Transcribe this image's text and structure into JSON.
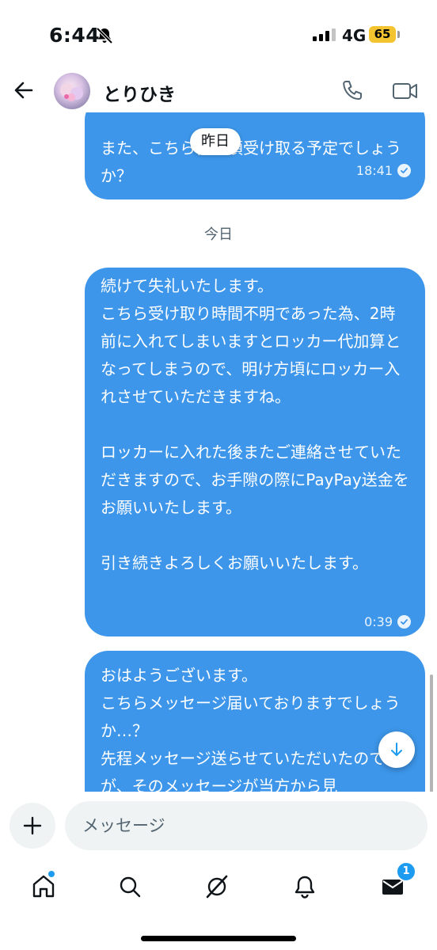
{
  "status_bar": {
    "time": "6:44",
    "network": "4G",
    "battery": "65"
  },
  "header": {
    "contact_name": "とりひき"
  },
  "messages": {
    "date_pill": "昨日",
    "date_separator": "今日",
    "items": [
      {
        "text": "また、こちら何時頃受け取る予定でしょうか？",
        "time": "18:41"
      },
      {
        "text": "続けて失礼いたします。\nこちら受け取り時間不明であった為、2時前に入れてしまいますとロッカー代加算となってしまうので、明け方頃にロッカー入れさせていただきますね。\n\nロッカーに入れた後またご連絡させていただきますので、お手隙の際にPayPay送金をお願いいたします。\n\n引き続きよろしくお願いいたします。",
        "time": "0:39"
      },
      {
        "text": "おはようございます。\nこちらメッセージ届いておりますでしょうか…？\n先程メッセージ送らせていただいたのですが、そのメッセージが当方から見",
        "time": ""
      }
    ]
  },
  "composer": {
    "placeholder": "メッセージ"
  },
  "nav": {
    "icons": [
      "home-icon",
      "search-icon",
      "grok-icon",
      "notifications-icon",
      "messages-icon"
    ],
    "messages_badge": "1"
  },
  "colors": {
    "bubble": "#3d96ea",
    "accent": "#1d9bf0"
  }
}
